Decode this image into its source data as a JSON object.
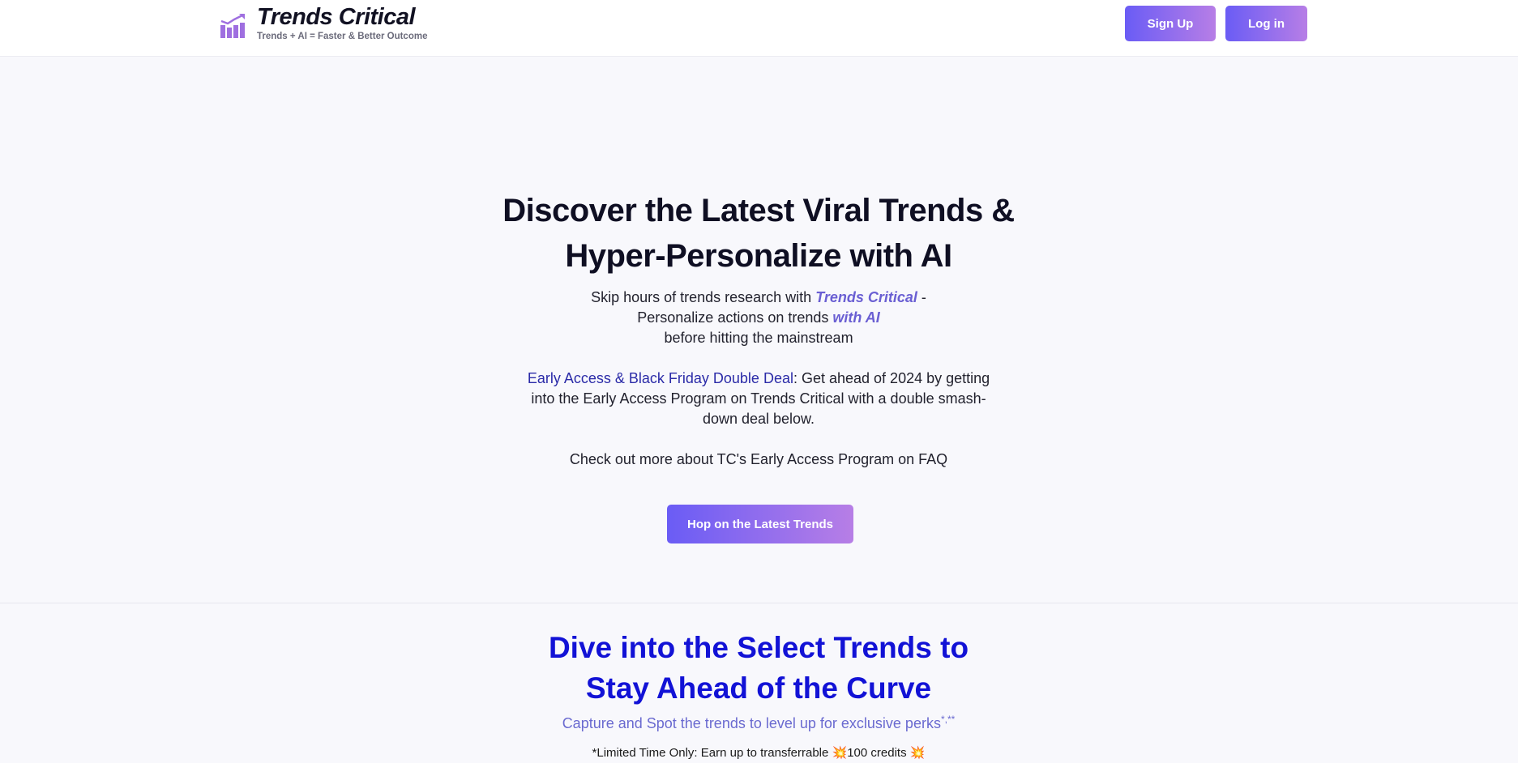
{
  "header": {
    "brand_name": "Trends Critical",
    "tagline": "Trends + AI = Faster & Better Outcome",
    "signup_label": "Sign Up",
    "login_label": "Log in"
  },
  "hero": {
    "title_line1": "Discover the Latest Viral Trends &",
    "title_line2": "Hyper-Personalize with AI",
    "para1_a": "Skip hours of trends research with ",
    "para1_em1": "Trends Critical",
    "para1_b": " -",
    "para1_c": "Personalize actions on trends ",
    "para1_em2": "with AI",
    "para1_d": "before hitting the mainstream",
    "deal_label": "Early Access & Black Friday Double Deal",
    "deal_text": ": Get ahead of 2024 by getting into the Early Access Program on Trends Critical with a double smash-down deal below.",
    "faq_text": "Check out more about TC's Early Access Program on FAQ",
    "cta_label": "Hop on the Latest Trends"
  },
  "section": {
    "title_line1": "Dive into the Select Trends to",
    "title_line2": "Stay Ahead of the Curve",
    "subtitle": "Capture and Spot the trends to level up for exclusive perks",
    "subtitle_sup": "*,**",
    "limited_a": "*Limited Time Only: Earn up to transferrable ",
    "limited_emoji": "💥",
    "limited_b": "100 credits ",
    "limited_emoji2": "💥"
  },
  "colors": {
    "accent_start": "#6a5cf5",
    "accent_end": "#b77ee6",
    "section_title": "#1212d6",
    "highlight": "#6a5fd3"
  },
  "icons": {
    "logo": "bar-chart-trend-icon"
  }
}
